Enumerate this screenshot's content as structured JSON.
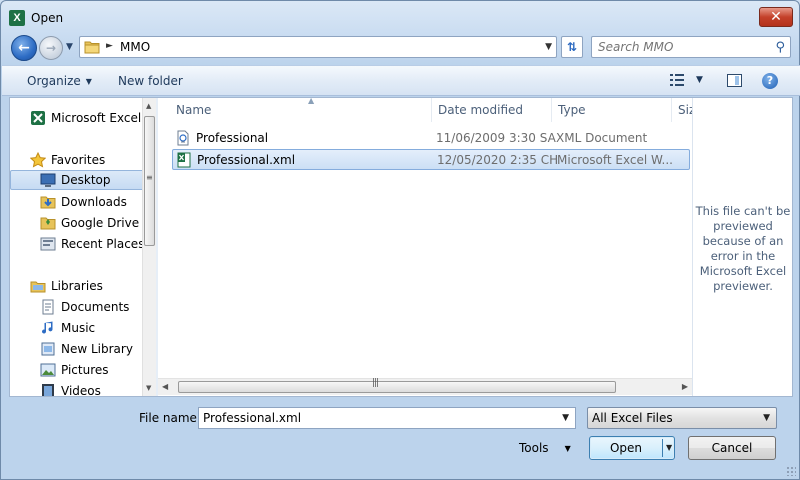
{
  "window": {
    "title": "Open",
    "app_icon": "X",
    "close_label": "✕"
  },
  "address": {
    "path": "MMO",
    "search_placeholder": "Search MMO"
  },
  "toolbar": {
    "organize_label": "Organize",
    "new_folder_label": "New folder",
    "help_label": "?"
  },
  "nav": {
    "app": "Microsoft Excel",
    "favorites": "Favorites",
    "desktop": "Desktop",
    "downloads": "Downloads",
    "google_drive": "Google Drive",
    "recent_places": "Recent Places",
    "libraries": "Libraries",
    "documents": "Documents",
    "music": "Music",
    "new_library": "New Library",
    "pictures": "Pictures",
    "videos": "Videos"
  },
  "columns": {
    "name": "Name",
    "date": "Date modified",
    "type": "Type",
    "size": "Size"
  },
  "files": [
    {
      "name": "Professional",
      "date": "11/06/2009 3:30 SA",
      "type": "XML Document"
    },
    {
      "name": "Professional.xml",
      "date": "12/05/2020 2:35 CH",
      "type": "Microsoft Excel W..."
    }
  ],
  "preview": {
    "message": "This file can't be previewed because of an error in the Microsoft Excel previewer."
  },
  "bottom": {
    "file_name_label": "File name:",
    "file_name_value": "Professional.xml",
    "filter_value": "All Excel Files",
    "tools_label": "Tools",
    "open_label": "Open",
    "cancel_label": "Cancel"
  },
  "colors": {
    "excel_green": "#1e7145",
    "selection_blue": "#cbdff5",
    "close_red": "#c4412b"
  },
  "icons": {
    "back": "back-arrow-icon",
    "forward": "forward-arrow-icon",
    "search": "search-icon",
    "refresh": "refresh-icon",
    "folder": "folder-icon",
    "star": "star-icon",
    "excel": "excel-icon",
    "xml": "xml-file-icon"
  }
}
